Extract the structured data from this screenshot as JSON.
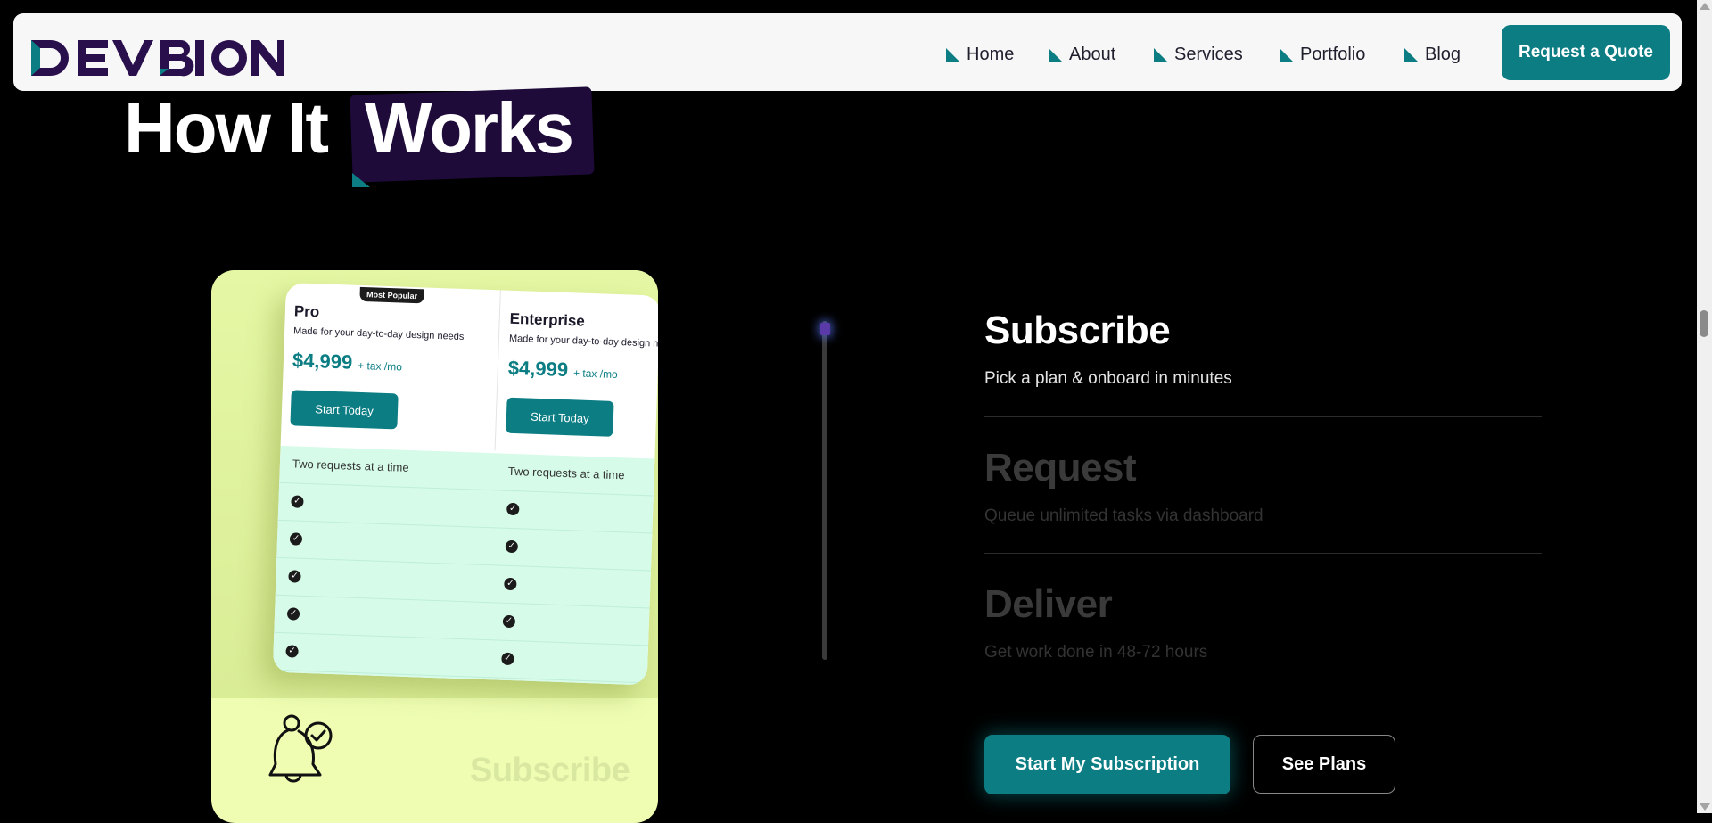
{
  "nav": {
    "brand": "DEVBION",
    "items": [
      {
        "label": "Home"
      },
      {
        "label": "About"
      },
      {
        "label": "Services"
      },
      {
        "label": "Portfolio"
      },
      {
        "label": "Blog"
      }
    ],
    "cta_label": "Request a Quote",
    "accent": "#0b7d83"
  },
  "heading": {
    "part1": "How It",
    "part2": "Works"
  },
  "card": {
    "badge": "Most Popular",
    "plans": [
      {
        "name": "Pro",
        "desc": "Made for your day-to-day design needs",
        "price": "$4,999",
        "price_note": "+ tax /mo",
        "button": "Start Today",
        "feature": "Two requests at a time"
      },
      {
        "name": "Enterprise",
        "desc": "Made for your day-to-day design needs",
        "price": "$4,999",
        "price_note": "+ tax /mo",
        "button": "Start Today",
        "feature": "Two requests at a time"
      }
    ],
    "caption": "Subscribe",
    "bell_icon": "bell-check-icon"
  },
  "steps": [
    {
      "title": "Subscribe",
      "desc": "Pick a plan & onboard in minutes",
      "active": true
    },
    {
      "title": "Request",
      "desc": "Queue unlimited tasks via dashboard",
      "active": false
    },
    {
      "title": "Deliver",
      "desc": "Get work done in 48-72 hours",
      "active": false
    }
  ],
  "progress": 0.02,
  "buttons": {
    "primary": "Start My Subscription",
    "secondary": "See Plans"
  }
}
